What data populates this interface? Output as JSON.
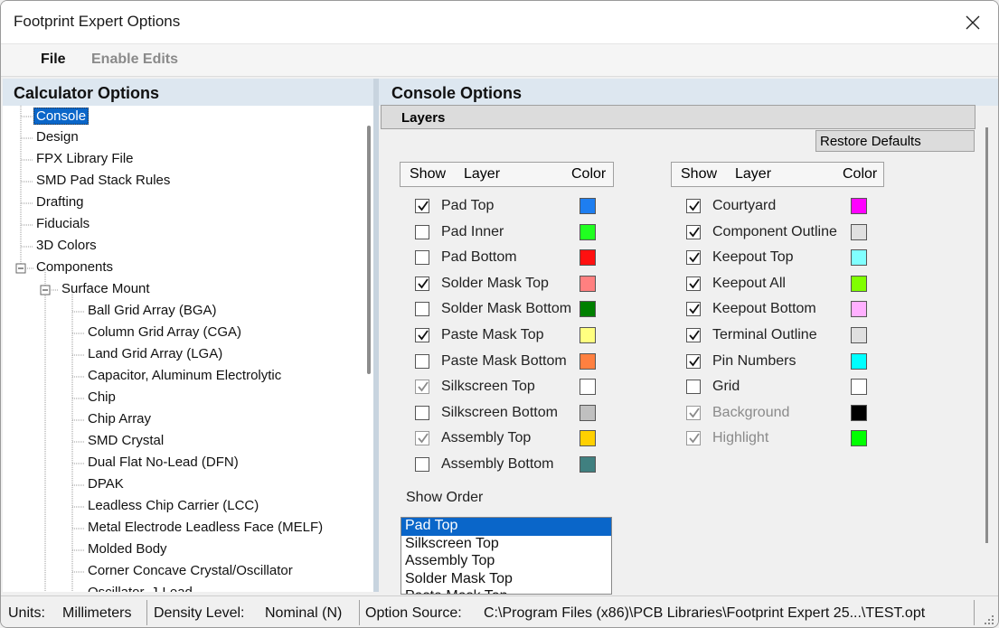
{
  "window": {
    "title": "Footprint Expert Options"
  },
  "menu": {
    "file": "File",
    "enable_edits": "Enable Edits"
  },
  "left_pane": {
    "heading": "Calculator Options",
    "tree": [
      {
        "label": "Console",
        "level": 0,
        "selected": true
      },
      {
        "label": "Design",
        "level": 0
      },
      {
        "label": "FPX Library File",
        "level": 0
      },
      {
        "label": "SMD Pad Stack Rules",
        "level": 0
      },
      {
        "label": "Drafting",
        "level": 0
      },
      {
        "label": "Fiducials",
        "level": 0
      },
      {
        "label": "3D Colors",
        "level": 0
      },
      {
        "label": "Components",
        "level": 0,
        "expandable": true
      },
      {
        "label": "Surface Mount",
        "level": 1,
        "expandable": true
      },
      {
        "label": "Ball Grid Array (BGA)",
        "level": 2
      },
      {
        "label": "Column Grid Array (CGA)",
        "level": 2
      },
      {
        "label": "Land Grid Array (LGA)",
        "level": 2
      },
      {
        "label": "Capacitor, Aluminum Electrolytic",
        "level": 2
      },
      {
        "label": "Chip",
        "level": 2
      },
      {
        "label": "Chip Array",
        "level": 2
      },
      {
        "label": "SMD Crystal",
        "level": 2
      },
      {
        "label": "Dual Flat No-Lead (DFN)",
        "level": 2
      },
      {
        "label": "DPAK",
        "level": 2
      },
      {
        "label": "Leadless Chip Carrier (LCC)",
        "level": 2
      },
      {
        "label": "Metal Electrode Leadless Face (MELF)",
        "level": 2
      },
      {
        "label": "Molded Body",
        "level": 2
      },
      {
        "label": "Corner Concave Crystal/Oscillator",
        "level": 2
      },
      {
        "label": "Oscillator, J-Lead",
        "level": 2
      }
    ]
  },
  "right_pane": {
    "heading": "Console Options",
    "layers_tab": "Layers",
    "restore_defaults": "Restore Defaults",
    "col_show": "Show",
    "col_layer": "Layer",
    "col_color": "Color",
    "layers_left": [
      {
        "label": "Pad Top",
        "checked": true,
        "disabled": false,
        "color": "#1e7ef0"
      },
      {
        "label": "Pad Inner",
        "checked": false,
        "disabled": false,
        "color": "#20ff20"
      },
      {
        "label": "Pad Bottom",
        "checked": false,
        "disabled": false,
        "color": "#ff1010"
      },
      {
        "label": "Solder Mask Top",
        "checked": true,
        "disabled": false,
        "color": "#ff8080"
      },
      {
        "label": "Solder Mask Bottom",
        "checked": false,
        "disabled": false,
        "color": "#008000"
      },
      {
        "label": "Paste Mask Top",
        "checked": true,
        "disabled": false,
        "color": "#ffff80"
      },
      {
        "label": "Paste Mask Bottom",
        "checked": false,
        "disabled": false,
        "color": "#ff8040"
      },
      {
        "label": "Silkscreen Top",
        "checked": true,
        "disabled": true,
        "color": "#ffffff"
      },
      {
        "label": "Silkscreen Bottom",
        "checked": false,
        "disabled": false,
        "color": "#c0c0c0"
      },
      {
        "label": "Assembly Top",
        "checked": true,
        "disabled": true,
        "color": "#ffd000"
      },
      {
        "label": "Assembly Bottom",
        "checked": false,
        "disabled": false,
        "color": "#408080"
      }
    ],
    "layers_right": [
      {
        "label": "Courtyard",
        "checked": true,
        "disabled": false,
        "color": "#ff00ff"
      },
      {
        "label": "Component Outline",
        "checked": true,
        "disabled": false,
        "color": "#e0e0e0"
      },
      {
        "label": "Keepout Top",
        "checked": true,
        "disabled": false,
        "color": "#80ffff"
      },
      {
        "label": "Keepout All",
        "checked": true,
        "disabled": false,
        "color": "#80ff00"
      },
      {
        "label": "Keepout Bottom",
        "checked": true,
        "disabled": false,
        "color": "#ffb0ff"
      },
      {
        "label": "Terminal Outline",
        "checked": true,
        "disabled": false,
        "color": "#e0e0e0"
      },
      {
        "label": "Pin Numbers",
        "checked": true,
        "disabled": false,
        "color": "#00ffff"
      },
      {
        "label": "Grid",
        "checked": false,
        "disabled": false,
        "color": "#ffffff"
      },
      {
        "label": "Background",
        "checked": true,
        "disabled": true,
        "color": "#000000"
      },
      {
        "label": "Highlight",
        "checked": true,
        "disabled": true,
        "color": "#00ff00"
      }
    ],
    "show_order_label": "Show Order",
    "show_order": [
      "Pad Top",
      "Silkscreen Top",
      "Assembly Top",
      "Solder Mask Top",
      "Paste Mask Top"
    ]
  },
  "status": {
    "units_label": "Units:",
    "units_value": "Millimeters",
    "density_label": "Density Level:",
    "density_value": "Nominal (N)",
    "source_label": "Option Source:",
    "source_value": "C:\\Program Files (x86)\\PCB Libraries\\Footprint Expert 25...\\TEST.opt"
  }
}
